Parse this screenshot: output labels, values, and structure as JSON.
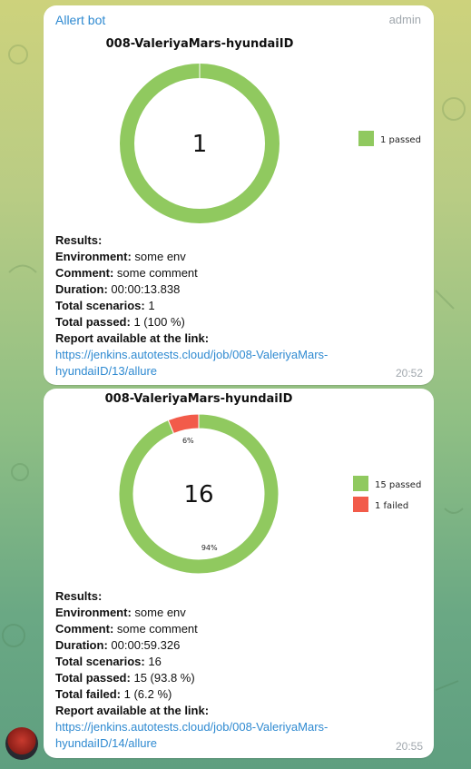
{
  "colors": {
    "passed": "#90c95f",
    "failed": "#f25b4a",
    "link": "#2f8ad1",
    "time": "#a0a7ad"
  },
  "messages": [
    {
      "sender": "Allert bot",
      "role": "admin",
      "time": "20:52",
      "chart_data": {
        "type": "pie",
        "title": "008-ValeriyaMars-hyundaiID",
        "center_label": "1",
        "slices": [
          {
            "label": "passed",
            "value": 1,
            "pct_label": ""
          }
        ],
        "legend": [
          {
            "text": "1 passed",
            "color": "#90c95f"
          }
        ],
        "legend_position": "right"
      },
      "results": {
        "heading": "Results:",
        "env_label": "Environment:",
        "env_value": "some env",
        "comment_label": "Comment:",
        "comment_value": "some comment",
        "duration_label": "Duration:",
        "duration_value": "00:00:13.838",
        "scenarios_label": "Total scenarios:",
        "scenarios_value": "1",
        "passed_label": "Total passed:",
        "passed_value": "1 (100 %)",
        "report_label": "Report available at the link:",
        "link": "https://jenkins.autotests.cloud/job/008-ValeriyaMars-hyundaiID/13/allure"
      }
    },
    {
      "time": "20:55",
      "chart_data": {
        "type": "pie",
        "title": "008-ValeriyaMars-hyundaiID",
        "center_label": "16",
        "slices": [
          {
            "label": "passed",
            "value": 15,
            "pct_label": "94%"
          },
          {
            "label": "failed",
            "value": 1,
            "pct_label": "6%"
          }
        ],
        "legend": [
          {
            "text": "15 passed",
            "color": "#90c95f"
          },
          {
            "text": "1 failed",
            "color": "#f25b4a"
          }
        ],
        "legend_position": "right"
      },
      "results": {
        "heading": "Results:",
        "env_label": "Environment:",
        "env_value": "some env",
        "comment_label": "Comment:",
        "comment_value": "some comment",
        "duration_label": "Duration:",
        "duration_value": "00:00:59.326",
        "scenarios_label": "Total scenarios:",
        "scenarios_value": "16",
        "passed_label": "Total passed:",
        "passed_value": "15 (93.8 %)",
        "failed_label": "Total failed:",
        "failed_value": "1 (6.2 %)",
        "report_label": "Report available at the link:",
        "link": "https://jenkins.autotests.cloud/job/008-ValeriyaMars-hyundaiID/14/allure"
      }
    }
  ]
}
